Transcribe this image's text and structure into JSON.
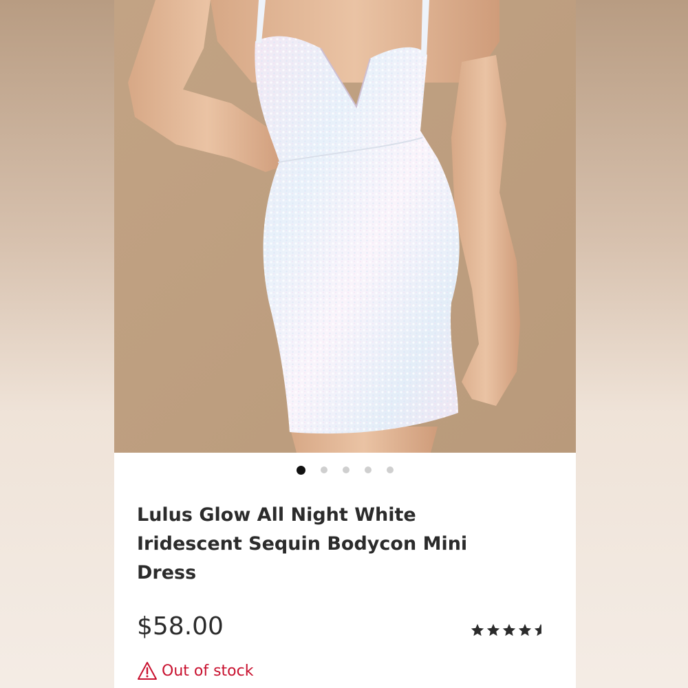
{
  "product": {
    "title": "Lulus Glow All Night White Iridescent Sequin Bodycon Mini Dress",
    "price": "$58.00",
    "stock_status": "Out of stock",
    "rating": 4.5,
    "rating_max": 5
  },
  "gallery": {
    "image_count": 5,
    "active_index": 0
  },
  "icons": {
    "stock": "warning-triangle-icon",
    "rating": "star-icon"
  },
  "colors": {
    "background": "#c5a88a",
    "text": "#2b2b2b",
    "out_of_stock": "#c8102e",
    "active_dot": "#111111",
    "inactive_dot": "#cfcfcf"
  }
}
